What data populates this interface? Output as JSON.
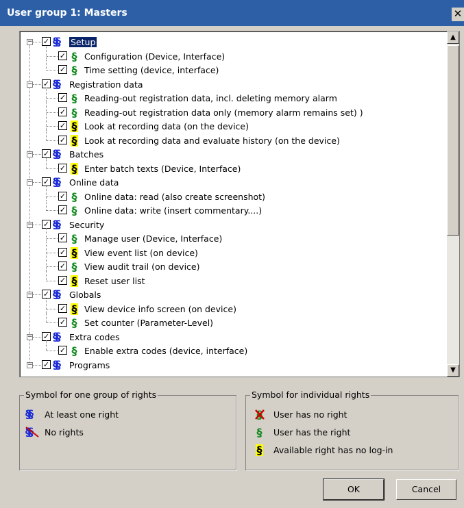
{
  "window": {
    "title": "User group 1: Masters",
    "close_glyph": "✕"
  },
  "tree": {
    "groups": [
      {
        "label": "Setup",
        "selected": true,
        "items": [
          {
            "label": "Configuration (Device, Interface)",
            "icon": "green"
          },
          {
            "label": "Time setting (device, interface)",
            "icon": "green"
          }
        ]
      },
      {
        "label": "Registration data",
        "items": [
          {
            "label": "Reading-out registration data, incl. deleting memory alarm",
            "icon": "green"
          },
          {
            "label": "Reading-out registration data only (memory alarm remains set) )",
            "icon": "green"
          },
          {
            "label": "Look at recording data (on the device)",
            "icon": "yellow"
          },
          {
            "label": "Look at recording data and evaluate history (on the device)",
            "icon": "yellow"
          }
        ]
      },
      {
        "label": "Batches",
        "items": [
          {
            "label": "Enter batch texts (Device, Interface)",
            "icon": "yellow"
          }
        ]
      },
      {
        "label": "Online data",
        "items": [
          {
            "label": "Online data: read (also create screenshot)",
            "icon": "green"
          },
          {
            "label": "Online data: write (insert commentary....)",
            "icon": "green"
          }
        ]
      },
      {
        "label": "Security",
        "items": [
          {
            "label": "Manage user (Device, Interface)",
            "icon": "green"
          },
          {
            "label": "View event list (on device)",
            "icon": "yellow"
          },
          {
            "label": "View audit trail (on device)",
            "icon": "green"
          },
          {
            "label": "Reset user list",
            "icon": "yellow"
          }
        ]
      },
      {
        "label": "Globals",
        "items": [
          {
            "label": "View device info screen (on device)",
            "icon": "yellow"
          },
          {
            "label": "Set counter (Parameter-Level)",
            "icon": "green"
          }
        ]
      },
      {
        "label": "Extra codes",
        "items": [
          {
            "label": "Enable extra codes (device, interface)",
            "icon": "green"
          }
        ]
      },
      {
        "label": "Programs",
        "items": []
      }
    ]
  },
  "legend_group": {
    "title": "Symbol for one group of rights",
    "at_least_one": "At least one right",
    "no_rights": "No rights"
  },
  "legend_individual": {
    "title": "Symbol for individual rights",
    "no_right": "User has no right",
    "has_right": "User has the right",
    "no_login": "Available right has no log-in"
  },
  "buttons": {
    "ok": "OK",
    "cancel": "Cancel"
  },
  "glyphs": {
    "section": "§",
    "check": "✓",
    "minus": "−",
    "up": "▲",
    "down": "▼"
  },
  "colors": {
    "title_bar": "#2c5fa6",
    "group_symbol": "#1a2bd6",
    "right_symbol": "#138a1f",
    "no_login_bg": "#ffff00",
    "no_right_x": "#d00000"
  }
}
